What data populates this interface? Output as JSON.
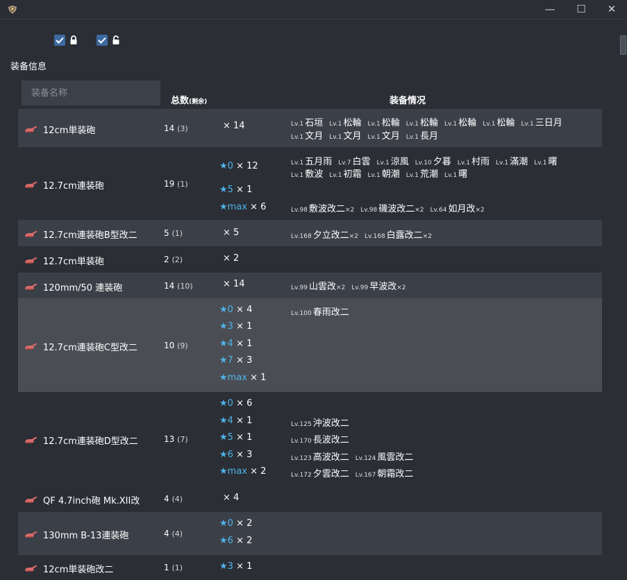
{
  "window": {
    "min_glyph": "—",
    "max_glyph": "☐",
    "close_glyph": "✕",
    "icon": "app-emblem-icon"
  },
  "filters": {
    "locked_checked": true,
    "unlocked_checked": true,
    "locked_icon": "lock-closed-icon",
    "unlocked_icon": "lock-open-icon"
  },
  "section_title": "装备信息",
  "table": {
    "search_placeholder": "装备名称",
    "header_total": "总数",
    "header_total_sub": "(剩余)",
    "header_info": "装备情况"
  },
  "colors": {
    "star": "#4fb4ea",
    "row_dark": "#3b3f47",
    "row_highlight": "#4a4d54",
    "icon": "#d96a6a"
  },
  "rows": [
    {
      "name": "12cm単装砲",
      "total": "14",
      "remaining": "(3)",
      "stars": [
        {
          "star": "",
          "count": "× 14"
        }
      ],
      "owners": [
        [
          {
            "lv": "Lv.1",
            "name": "石垣",
            "count": ""
          },
          {
            "lv": "Lv.1",
            "name": "松輪",
            "count": ""
          },
          {
            "lv": "Lv.1",
            "name": "松輪",
            "count": ""
          },
          {
            "lv": "Lv.1",
            "name": "松輪",
            "count": ""
          },
          {
            "lv": "Lv.1",
            "name": "松輪",
            "count": ""
          },
          {
            "lv": "Lv.1",
            "name": "松輪",
            "count": ""
          },
          {
            "lv": "Lv.1",
            "name": "三日月",
            "count": ""
          }
        ],
        [
          {
            "lv": "Lv.1",
            "name": "文月",
            "count": ""
          },
          {
            "lv": "Lv.1",
            "name": "文月",
            "count": ""
          },
          {
            "lv": "Lv.1",
            "name": "文月",
            "count": ""
          },
          {
            "lv": "Lv.1",
            "name": "長月",
            "count": ""
          }
        ]
      ]
    },
    {
      "name": "12.7cm連装砲",
      "total": "19",
      "remaining": "(1)",
      "stars": [
        {
          "star": "★0",
          "count": "× 12"
        },
        {
          "star": "★5",
          "count": "× 1"
        },
        {
          "star": "★max",
          "count": "× 6"
        }
      ],
      "owners": [
        [
          {
            "lv": "Lv.1",
            "name": "五月雨",
            "count": ""
          },
          {
            "lv": "Lv.7",
            "name": "白雲",
            "count": ""
          },
          {
            "lv": "Lv.1",
            "name": "涼風",
            "count": ""
          },
          {
            "lv": "Lv.10",
            "name": "夕暮",
            "count": ""
          },
          {
            "lv": "Lv.1",
            "name": "村雨",
            "count": ""
          },
          {
            "lv": "Lv.1",
            "name": "滿潮",
            "count": ""
          },
          {
            "lv": "Lv.1",
            "name": "曙",
            "count": ""
          }
        ],
        [
          {
            "lv": "Lv.1",
            "name": "敷波",
            "count": ""
          },
          {
            "lv": "Lv.1",
            "name": "初霜",
            "count": ""
          },
          {
            "lv": "Lv.1",
            "name": "朝潮",
            "count": ""
          },
          {
            "lv": "Lv.1",
            "name": "荒潮",
            "count": ""
          },
          {
            "lv": "Lv.1",
            "name": "曙",
            "count": ""
          }
        ],
        [
          {
            "lv": "Lv.98",
            "name": "敷波改二",
            "count": "×2"
          },
          {
            "lv": "Lv.98",
            "name": "磯波改二",
            "count": "×2"
          },
          {
            "lv": "Lv.64",
            "name": "如月改",
            "count": "×2"
          }
        ]
      ]
    },
    {
      "name": "12.7cm連装砲B型改二",
      "total": "5",
      "remaining": "(1)",
      "stars": [
        {
          "star": "",
          "count": "× 5"
        }
      ],
      "owners": [
        [
          {
            "lv": "Lv.168",
            "name": "夕立改二",
            "count": "×2"
          },
          {
            "lv": "Lv.168",
            "name": "白露改二",
            "count": "×2"
          }
        ]
      ]
    },
    {
      "name": "12.7cm単装砲",
      "total": "2",
      "remaining": "(2)",
      "stars": [
        {
          "star": "",
          "count": "× 2"
        }
      ],
      "owners": []
    },
    {
      "name": "120mm/50 連装砲",
      "total": "14",
      "remaining": "(10)",
      "stars": [
        {
          "star": "",
          "count": "× 14"
        }
      ],
      "owners": [
        [
          {
            "lv": "Lv.99",
            "name": "山雲改",
            "count": "×2"
          },
          {
            "lv": "Lv.99",
            "name": "早波改",
            "count": "×2"
          }
        ]
      ]
    },
    {
      "name": "12.7cm連装砲C型改二",
      "total": "10",
      "remaining": "(9)",
      "stars": [
        {
          "star": "★0",
          "count": "× 4"
        },
        {
          "star": "★3",
          "count": "× 1"
        },
        {
          "star": "★4",
          "count": "× 1"
        },
        {
          "star": "★7",
          "count": "× 3"
        },
        {
          "star": "★max",
          "count": "× 1"
        }
      ],
      "owners": [
        [
          {
            "lv": "Lv.100",
            "name": "春雨改二",
            "count": ""
          }
        ]
      ]
    },
    {
      "name": "12.7cm連装砲D型改二",
      "total": "13",
      "remaining": "(7)",
      "stars": [
        {
          "star": "★0",
          "count": "× 6"
        },
        {
          "star": "★4",
          "count": "× 1"
        },
        {
          "star": "★5",
          "count": "× 1"
        },
        {
          "star": "★6",
          "count": "× 3"
        },
        {
          "star": "★max",
          "count": "× 2"
        }
      ],
      "owners": [
        [],
        [
          {
            "lv": "Lv.125",
            "name": "沖波改二",
            "count": ""
          }
        ],
        [
          {
            "lv": "Lv.170",
            "name": "長波改二",
            "count": ""
          }
        ],
        [
          {
            "lv": "Lv.123",
            "name": "高波改二",
            "count": ""
          },
          {
            "lv": "Lv.124",
            "name": "風雲改二",
            "count": ""
          }
        ],
        [
          {
            "lv": "Lv.172",
            "name": "夕雲改二",
            "count": ""
          },
          {
            "lv": "Lv.167",
            "name": "朝霜改二",
            "count": ""
          }
        ]
      ]
    },
    {
      "name": "QF 4.7inch砲 Mk.XII改",
      "total": "4",
      "remaining": "(4)",
      "stars": [
        {
          "star": "",
          "count": "× 4"
        }
      ],
      "owners": []
    },
    {
      "name": "130mm B-13連装砲",
      "total": "4",
      "remaining": "(4)",
      "stars": [
        {
          "star": "★0",
          "count": "× 2"
        },
        {
          "star": "★6",
          "count": "× 2"
        }
      ],
      "owners": []
    },
    {
      "name": "12cm単装砲改二",
      "total": "1",
      "remaining": "(1)",
      "stars": [
        {
          "star": "★3",
          "count": "× 1"
        }
      ],
      "owners": []
    }
  ]
}
